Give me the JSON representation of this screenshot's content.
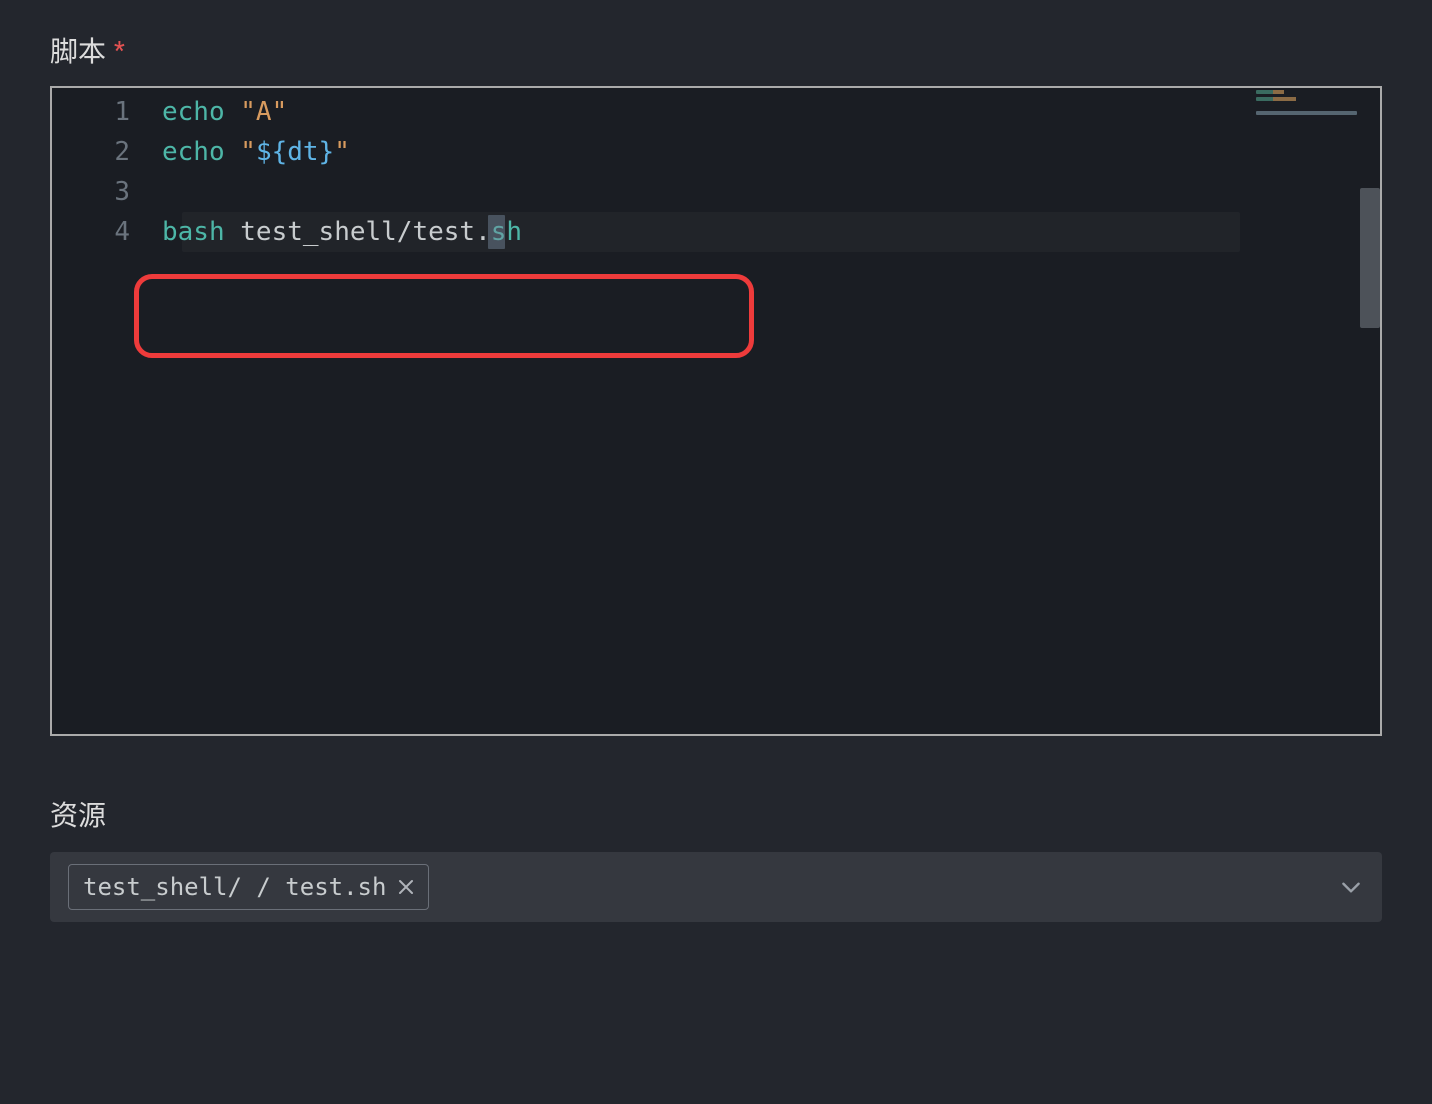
{
  "script": {
    "label": "脚本",
    "required_mark": "*",
    "lines": [
      {
        "n": "1",
        "tokens": [
          {
            "t": "echo",
            "cls": "tok-cmd"
          },
          {
            "t": " ",
            "cls": "tok-plain"
          },
          {
            "t": "\"A\"",
            "cls": "tok-string"
          }
        ]
      },
      {
        "n": "2",
        "tokens": [
          {
            "t": "echo",
            "cls": "tok-cmd"
          },
          {
            "t": " ",
            "cls": "tok-plain"
          },
          {
            "t": "\"",
            "cls": "tok-string"
          },
          {
            "t": "${dt}",
            "cls": "tok-var"
          },
          {
            "t": "\"",
            "cls": "tok-string"
          }
        ]
      },
      {
        "n": "3",
        "tokens": []
      },
      {
        "n": "4",
        "tokens": [
          {
            "t": "bash",
            "cls": "tok-cmd"
          },
          {
            "t": " test_shell/test.",
            "cls": "tok-plain"
          },
          {
            "t": "sh",
            "cls": "tok-cmd"
          }
        ],
        "current": true
      }
    ]
  },
  "resources": {
    "label": "资源",
    "chip_text": "test_shell/ / test.sh"
  }
}
